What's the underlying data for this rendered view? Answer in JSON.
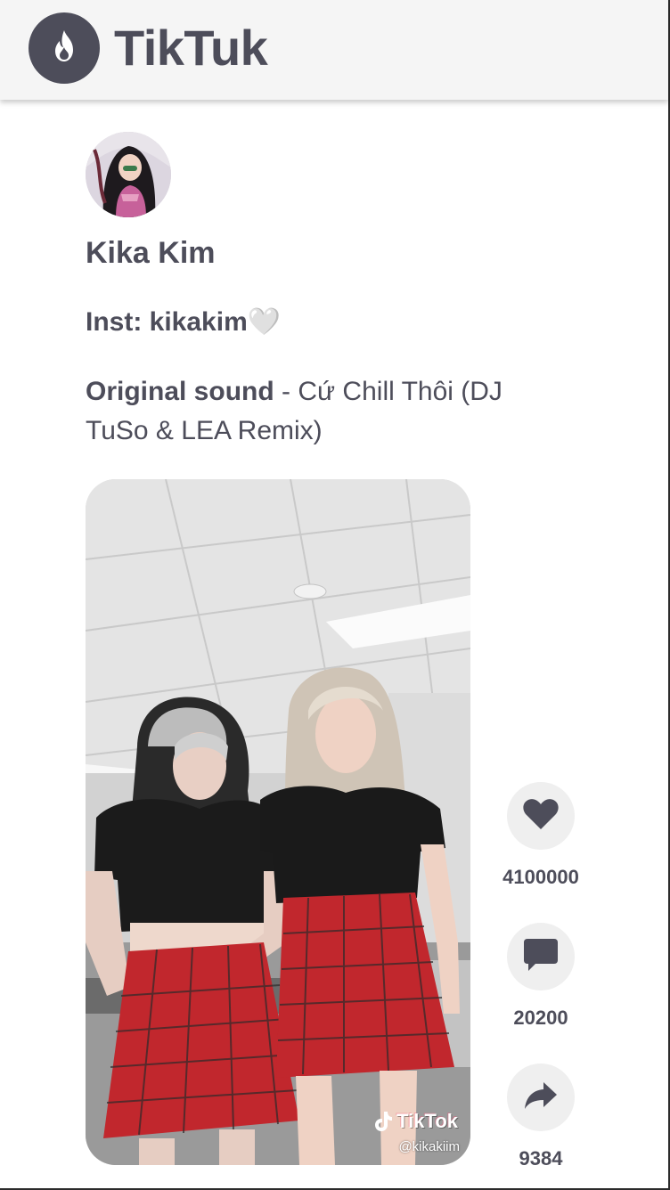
{
  "app": {
    "name": "TikTuk",
    "logo_icon": "flame-icon",
    "colors": {
      "brand": "#4d4d5a",
      "header_bg": "#f5f5f5",
      "button_bg": "#efefef"
    }
  },
  "post": {
    "author": "Kika Kim",
    "caption": "Inst: kikakim🤍",
    "sound_label": "Original sound",
    "sound_separator": " - ",
    "sound_title": "Cứ Chill Thôi (DJ TuSo & LEA Remix)",
    "video": {
      "watermark_brand": "TikTok",
      "watermark_handle": "@kikakiim"
    }
  },
  "actions": {
    "likes": {
      "icon": "heart-icon",
      "count": "4100000"
    },
    "comments": {
      "icon": "comment-icon",
      "count": "20200"
    },
    "shares": {
      "icon": "share-icon",
      "count": "9384"
    }
  }
}
